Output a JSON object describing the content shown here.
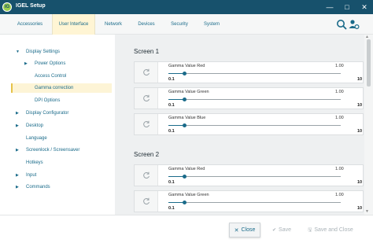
{
  "window": {
    "title": "IGEL Setup",
    "logo_text": "IG",
    "min_glyph": "—",
    "max_glyph": "□",
    "close_glyph": "✕"
  },
  "tabs": [
    {
      "label": "Accessories"
    },
    {
      "label": "User Interface"
    },
    {
      "label": "Network"
    },
    {
      "label": "Devices"
    },
    {
      "label": "Security"
    },
    {
      "label": "System"
    }
  ],
  "sidebar": {
    "items": [
      {
        "label": "Display Settings",
        "caret": "▼"
      },
      {
        "label": "Power Options",
        "caret": "▶"
      },
      {
        "label": "Access Control",
        "caret": ""
      },
      {
        "label": "Gamma correction",
        "caret": ""
      },
      {
        "label": "DPI Options",
        "caret": ""
      },
      {
        "label": "Display Configurator",
        "caret": "▶"
      },
      {
        "label": "Desktop",
        "caret": "▶"
      },
      {
        "label": "Language",
        "caret": ""
      },
      {
        "label": "Screenlock / Screensaver",
        "caret": "▶"
      },
      {
        "label": "Hotkeys",
        "caret": ""
      },
      {
        "label": "Input",
        "caret": "▶"
      },
      {
        "label": "Commands",
        "caret": "▶"
      }
    ]
  },
  "screens": [
    {
      "title": "Screen 1",
      "rows": [
        {
          "label": "Gamma Value Red",
          "value": "1.00",
          "min": "0.1",
          "max": "10",
          "level": 0.09
        },
        {
          "label": "Gamma Value Green",
          "value": "1.00",
          "min": "0.1",
          "max": "10",
          "level": 0.09
        },
        {
          "label": "Gamma Value Blue",
          "value": "1.00",
          "min": "0.1",
          "max": "10",
          "level": 0.09
        }
      ]
    },
    {
      "title": "Screen 2",
      "rows": [
        {
          "label": "Gamma Value Red",
          "value": "1.00",
          "min": "0.1",
          "max": "10",
          "level": 0.09
        },
        {
          "label": "Gamma Value Green",
          "value": "1.00",
          "min": "0.1",
          "max": "10",
          "level": 0.09
        }
      ]
    }
  ],
  "footer": {
    "close": "Close",
    "save": "Save",
    "save_close": "Save and Close",
    "close_glyph": "✕",
    "save_glyph": "✔",
    "save_close_glyph": "🖫"
  },
  "icons": {
    "reset": "refresh-icon",
    "info": "i",
    "scroll_up": "▲",
    "scroll_down": "▼"
  },
  "colors": {
    "titlebar": "#17516c",
    "accent": "#1a6b8a",
    "active_tab": "#fff5d4",
    "selected_marker": "#e6c34a"
  }
}
